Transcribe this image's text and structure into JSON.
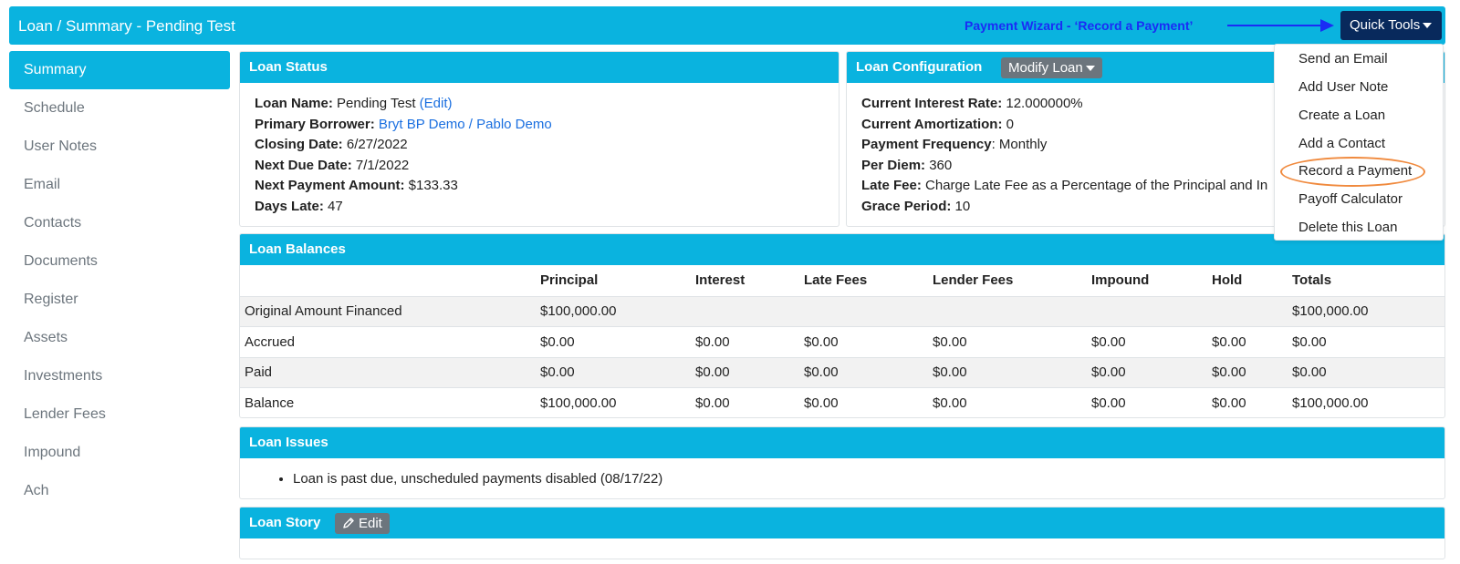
{
  "header": {
    "title": "Loan / Summary - Pending Test",
    "annotation": "Payment Wizard - ‘Record a Payment’",
    "quick_tools_label": "Quick Tools"
  },
  "sidebar": {
    "items": [
      {
        "label": "Summary"
      },
      {
        "label": "Schedule"
      },
      {
        "label": "User Notes"
      },
      {
        "label": "Email"
      },
      {
        "label": "Contacts"
      },
      {
        "label": "Documents"
      },
      {
        "label": "Register"
      },
      {
        "label": "Assets"
      },
      {
        "label": "Investments"
      },
      {
        "label": "Lender Fees"
      },
      {
        "label": "Impound"
      },
      {
        "label": "Ach"
      }
    ],
    "active": "Summary"
  },
  "loan_status": {
    "title": "Loan Status",
    "loan_name_label": "Loan Name:",
    "loan_name": "Pending Test",
    "edit_link": "(Edit)",
    "borrower_label": "Primary Borrower:",
    "borrower": "Bryt BP Demo / Pablo Demo",
    "closing_label": "Closing Date:",
    "closing": "6/27/2022",
    "next_due_label": "Next Due Date:",
    "next_due": "7/1/2022",
    "next_payment_label": "Next Payment Amount:",
    "next_payment": "$133.33",
    "days_late_label": "Days Late:",
    "days_late": "47"
  },
  "loan_config": {
    "title": "Loan Configuration",
    "modify_label": "Modify Loan",
    "rate_label": "Current Interest Rate:",
    "rate": "12.000000%",
    "amort_label": "Current Amortization:",
    "amort": "0",
    "freq_label": "Payment Frequency",
    "freq": ": Monthly",
    "per_diem_label": "Per Diem:",
    "per_diem": "360",
    "late_fee_label": "Late Fee:",
    "late_fee": "Charge Late Fee as a Percentage of the Principal and In",
    "grace_label": "Grace Period:",
    "grace": "10"
  },
  "quick_tools_menu": {
    "items": [
      {
        "label": "Send an Email"
      },
      {
        "label": "Add User Note"
      },
      {
        "label": "Create a Loan"
      },
      {
        "label": "Add a Contact"
      },
      {
        "label": "Record a Payment"
      },
      {
        "label": "Payoff Calculator"
      },
      {
        "label": "Delete this Loan"
      }
    ],
    "highlighted": "Record a Payment"
  },
  "balances": {
    "title": "Loan Balances",
    "columns": [
      "",
      "Principal",
      "Interest",
      "Late Fees",
      "Lender Fees",
      "Impound",
      "Hold",
      "Totals"
    ],
    "rows": [
      {
        "cells": [
          "Original Amount Financed",
          "$100,000.00",
          "",
          "",
          "",
          "",
          "",
          "$100,000.00"
        ]
      },
      {
        "cells": [
          "Accrued",
          "$0.00",
          "$0.00",
          "$0.00",
          "$0.00",
          "$0.00",
          "$0.00",
          "$0.00"
        ]
      },
      {
        "cells": [
          "Paid",
          "$0.00",
          "$0.00",
          "$0.00",
          "$0.00",
          "$0.00",
          "$0.00",
          "$0.00"
        ]
      },
      {
        "cells": [
          "Balance",
          "$100,000.00",
          "$0.00",
          "$0.00",
          "$0.00",
          "$0.00",
          "$0.00",
          "$100,000.00"
        ]
      }
    ]
  },
  "issues": {
    "title": "Loan Issues",
    "items": [
      "Loan is past due, unscheduled payments disabled (08/17/22)"
    ]
  },
  "story": {
    "title": "Loan Story",
    "edit_label": "Edit"
  },
  "colors": {
    "accent": "#0ab3df",
    "quick_tools_bg": "#08295c",
    "annotation": "#1a2cf5",
    "highlight_circle": "#f08a3e",
    "link": "#1a6fe0"
  }
}
